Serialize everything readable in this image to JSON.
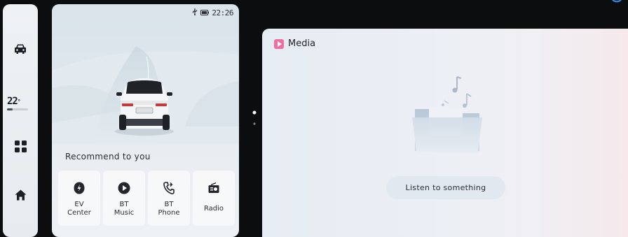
{
  "status_bar": {
    "icons": [
      "usb-icon",
      "battery-icon"
    ],
    "time": "22:26"
  },
  "sidebar": {
    "items": [
      {
        "name": "vehicle",
        "icon": "car-icon"
      },
      {
        "name": "apps",
        "icon": "grid-icon"
      },
      {
        "name": "home",
        "icon": "home-icon"
      }
    ],
    "climate": {
      "temperature": "22",
      "unit": "°"
    }
  },
  "home_card": {
    "recommend_label": "Recommend to you",
    "apps": [
      {
        "label": "EV\nCenter",
        "icon": "ev-center-icon"
      },
      {
        "label": "BT\nMusic",
        "icon": "bt-music-icon"
      },
      {
        "label": "BT\nPhone",
        "icon": "bt-phone-icon"
      },
      {
        "label": "Radio",
        "icon": "radio-icon"
      }
    ]
  },
  "media_card": {
    "title": "Media",
    "empty_icon": "empty-folder-music-icon",
    "action_label": "Listen to something"
  },
  "colors": {
    "background": "#0c0d0f",
    "media_accent": "#f06da2",
    "corner_accent": "#2d8cf0"
  }
}
